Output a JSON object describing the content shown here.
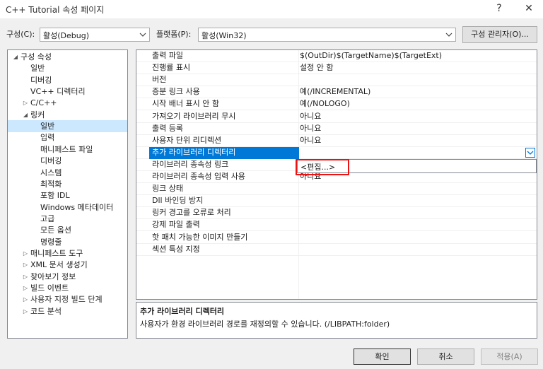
{
  "window": {
    "title": "C++ Tutorial 속성 페이지",
    "help_label": "?",
    "close_label": "✕"
  },
  "config": {
    "config_label": "구성(C):",
    "config_value": "활성(Debug)",
    "platform_label": "플랫폼(P):",
    "platform_value": "활성(Win32)",
    "manager_button": "구성 관리자(O)..."
  },
  "tree": {
    "items": [
      {
        "label": "구성 속성",
        "level": 0,
        "glyph": "◢"
      },
      {
        "label": "일반",
        "level": 1,
        "glyph": ""
      },
      {
        "label": "디버깅",
        "level": 1,
        "glyph": ""
      },
      {
        "label": "VC++ 디렉터리",
        "level": 1,
        "glyph": ""
      },
      {
        "label": "C/C++",
        "level": 1,
        "glyph": "▷"
      },
      {
        "label": "링커",
        "level": 1,
        "glyph": "◢"
      },
      {
        "label": "일반",
        "level": 2,
        "glyph": "",
        "selected": true
      },
      {
        "label": "입력",
        "level": 2,
        "glyph": ""
      },
      {
        "label": "매니페스트 파일",
        "level": 2,
        "glyph": ""
      },
      {
        "label": "디버깅",
        "level": 2,
        "glyph": ""
      },
      {
        "label": "시스템",
        "level": 2,
        "glyph": ""
      },
      {
        "label": "최적화",
        "level": 2,
        "glyph": ""
      },
      {
        "label": "포함 IDL",
        "level": 2,
        "glyph": ""
      },
      {
        "label": "Windows 메타데이터",
        "level": 2,
        "glyph": ""
      },
      {
        "label": "고급",
        "level": 2,
        "glyph": ""
      },
      {
        "label": "모든 옵션",
        "level": 2,
        "glyph": ""
      },
      {
        "label": "명령줄",
        "level": 2,
        "glyph": ""
      },
      {
        "label": "매니페스트 도구",
        "level": 1,
        "glyph": "▷"
      },
      {
        "label": "XML 문서 생성기",
        "level": 1,
        "glyph": "▷"
      },
      {
        "label": "찾아보기 정보",
        "level": 1,
        "glyph": "▷"
      },
      {
        "label": "빌드 이벤트",
        "level": 1,
        "glyph": "▷"
      },
      {
        "label": "사용자 지정 빌드 단계",
        "level": 1,
        "glyph": "▷"
      },
      {
        "label": "코드 분석",
        "level": 1,
        "glyph": "▷"
      }
    ]
  },
  "grid": {
    "rows": [
      {
        "name": "출력 파일",
        "value": "$(OutDir)$(TargetName)$(TargetExt)"
      },
      {
        "name": "진행률 표시",
        "value": "설정 안 함"
      },
      {
        "name": "버전",
        "value": ""
      },
      {
        "name": "증분 링크 사용",
        "value": "예(/INCREMENTAL)"
      },
      {
        "name": "시작 배너 표시 안 함",
        "value": "예(/NOLOGO)"
      },
      {
        "name": "가져오기 라이브러리 무시",
        "value": "아니요"
      },
      {
        "name": "출력 등록",
        "value": "아니요"
      },
      {
        "name": "사용자 단위 리디렉션",
        "value": "아니요"
      },
      {
        "name": "추가 라이브러리 디렉터리",
        "value": "",
        "selected": true
      },
      {
        "name": "라이브러리 종속성 링크",
        "value": ""
      },
      {
        "name": "라이브러리 종속성 입력 사용",
        "value": "아니요"
      },
      {
        "name": "링크 상태",
        "value": ""
      },
      {
        "name": "Dll 바인딩 방지",
        "value": ""
      },
      {
        "name": "링커 경고를 오류로 처리",
        "value": ""
      },
      {
        "name": "강제 파일 출력",
        "value": ""
      },
      {
        "name": "핫 패치 가능한 이미지 만들기",
        "value": ""
      },
      {
        "name": "섹션 특성 지정",
        "value": ""
      }
    ],
    "dropdown_option": "<편집...>"
  },
  "description": {
    "title": "추가 라이브러리 디렉터리",
    "text": "사용자가 환경 라이브러리 경로를 재정의할 수 있습니다. (/LIBPATH:folder)"
  },
  "buttons": {
    "ok": "확인",
    "cancel": "취소",
    "apply": "적용(A)"
  },
  "colors": {
    "selection": "#0078d7",
    "tree_selection": "#cce8ff",
    "highlight_box": "#e11111"
  }
}
